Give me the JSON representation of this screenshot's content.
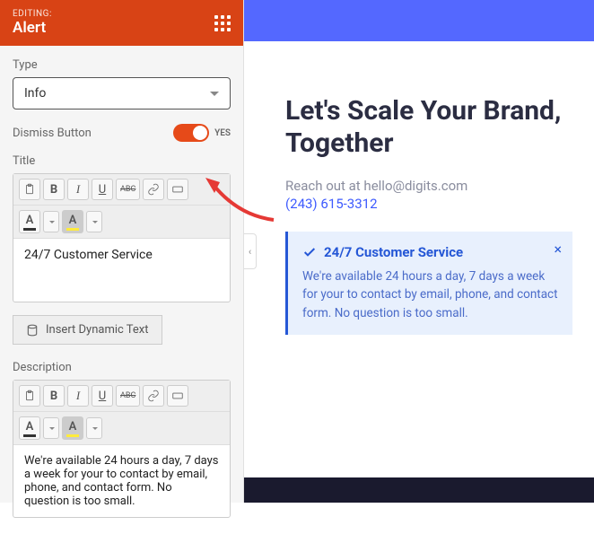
{
  "sidebar": {
    "editing_label": "EDITING:",
    "title": "Alert",
    "fields": {
      "type": {
        "label": "Type",
        "value": "Info"
      },
      "dismiss": {
        "label": "Dismiss Button",
        "value": "YES"
      },
      "title": {
        "label": "Title",
        "content": "24/7 Customer Service"
      },
      "description": {
        "label": "Description",
        "content": "We're available 24 hours a day, 7 days a week for your to contact by email, phone, and contact form. No question is too small."
      },
      "insert_dynamic": "Insert Dynamic Text"
    },
    "toolbar": {
      "bold": "B",
      "italic": "I",
      "underline": "U",
      "strike": "ABC",
      "textcolor": "A",
      "bgcolor": "A"
    }
  },
  "preview": {
    "heading": "Let's Scale Your Brand, Together",
    "reach_out": "Reach out at hello@digits.com",
    "phone": "(243) 615-3312",
    "alert": {
      "title": "24/7 Customer Service",
      "body": "We're available 24 hours a day, 7 days a week for your to contact by email, phone, and contact form. No question is too small."
    },
    "collapse": "‹"
  }
}
